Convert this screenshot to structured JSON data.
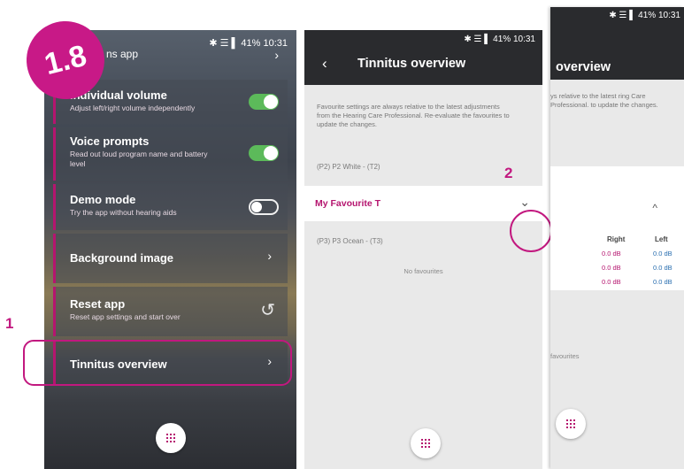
{
  "badge": {
    "label": "1.8"
  },
  "steps": {
    "one": "1",
    "two": "2"
  },
  "status_bar": {
    "time": "10:31",
    "battery": "41%",
    "icons": "✱ ☰ ▌"
  },
  "phone1": {
    "top_item_label": "ns app",
    "rows": [
      {
        "title": "Individual volume",
        "subtitle": "Adjust left/right volume independently",
        "control": "toggle",
        "state": "on"
      },
      {
        "title": "Voice prompts",
        "subtitle": "Read out loud program name and battery level",
        "control": "toggle",
        "state": "on"
      },
      {
        "title": "Demo mode",
        "subtitle": "Try the app without hearing aids",
        "control": "toggle",
        "state": "off"
      },
      {
        "title": "Background image",
        "subtitle": "",
        "control": "chevron-right-icon"
      },
      {
        "title": "Reset app",
        "subtitle": "Reset app settings and start over",
        "control": "reset-icon"
      },
      {
        "title": "Tinnitus overview",
        "subtitle": "",
        "control": "chevron-right-icon"
      }
    ]
  },
  "phone2": {
    "title": "Tinnitus overview",
    "note": "Favourite settings are always relative to the latest adjustments from the Hearing Care Professional. Re-evaluate the favourites to update the changes.",
    "program_1": "(P2) P2 White - (T2)",
    "favourite": "My Favourite T",
    "program_2": "(P3) P3 Ocean - (T3)",
    "no_favourites": "No favourites"
  },
  "phone3": {
    "title": "overview",
    "note": "ys relative to the latest ring Care Professional. to update the changes.",
    "col_right": "Right",
    "col_left": "Left",
    "values_right": [
      "0.0 dB",
      "0.0 dB",
      "0.0 dB"
    ],
    "values_left": [
      "0.0 dB",
      "0.0 dB",
      "0.0 dB"
    ],
    "no_favourites": "favourites"
  },
  "colors": {
    "accent": "#c2187f",
    "toggle_on": "#5cba5a",
    "appbar": "#2a2b2e"
  }
}
